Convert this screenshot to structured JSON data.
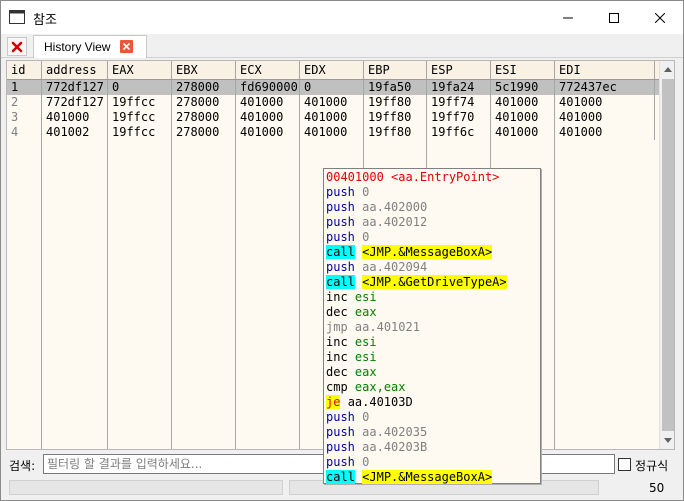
{
  "window": {
    "title": "참조"
  },
  "tabs": {
    "history_label": "History View"
  },
  "table": {
    "columns": [
      "id",
      "address",
      "EAX",
      "EBX",
      "ECX",
      "EDX",
      "EBP",
      "ESP",
      "ESI",
      "EDI"
    ],
    "rows": [
      [
        "1",
        "772df127",
        "0",
        "278000",
        "fd690000",
        "0",
        "19fa50",
        "19fa24",
        "5c1990",
        "772437ec"
      ],
      [
        "2",
        "772df127",
        "19ffcc",
        "278000",
        "401000",
        "401000",
        "19ff80",
        "19ff74",
        "401000",
        "401000"
      ],
      [
        "3",
        "401000",
        "19ffcc",
        "278000",
        "401000",
        "401000",
        "19ff80",
        "19ff70",
        "401000",
        "401000"
      ],
      [
        "4",
        "401002",
        "19ffcc",
        "278000",
        "401000",
        "401000",
        "19ff80",
        "19ff6c",
        "401000",
        "401000"
      ]
    ],
    "selected_row": "1"
  },
  "disassembly": {
    "header": "00401000 <aa.EntryPoint>",
    "lines": [
      {
        "mn": "push",
        "op": "0",
        "style": "push",
        "opstyle": "num"
      },
      {
        "mn": "push",
        "op": "aa.402000",
        "style": "push",
        "opstyle": "addr"
      },
      {
        "mn": "push",
        "op": "aa.402012",
        "style": "push",
        "opstyle": "addr"
      },
      {
        "mn": "push",
        "op": "0",
        "style": "push",
        "opstyle": "num"
      },
      {
        "mn": "call",
        "op": "<JMP.&MessageBoxA>",
        "style": "call",
        "opstyle": "label"
      },
      {
        "mn": "push",
        "op": "aa.402094",
        "style": "push",
        "opstyle": "addr"
      },
      {
        "mn": "call",
        "op": "<JMP.&GetDriveTypeA>",
        "style": "call",
        "opstyle": "label"
      },
      {
        "mn": "inc",
        "op": "esi",
        "style": "plain",
        "opstyle": "reg"
      },
      {
        "mn": "dec",
        "op": "eax",
        "style": "plain",
        "opstyle": "reg"
      },
      {
        "mn": "jmp",
        "op": "aa.401021",
        "style": "jmp",
        "opstyle": "addr"
      },
      {
        "mn": "inc",
        "op": "esi",
        "style": "plain",
        "opstyle": "reg"
      },
      {
        "mn": "inc",
        "op": "esi",
        "style": "plain",
        "opstyle": "reg"
      },
      {
        "mn": "dec",
        "op": "eax",
        "style": "plain",
        "opstyle": "reg"
      },
      {
        "mn": "cmp",
        "op": "eax,eax",
        "style": "plain",
        "opstyle": "reg"
      },
      {
        "mn": "je",
        "op": "aa.40103D",
        "style": "je",
        "opstyle": "plainlabel"
      },
      {
        "mn": "push",
        "op": "0",
        "style": "push",
        "opstyle": "num"
      },
      {
        "mn": "push",
        "op": "aa.402035",
        "style": "push",
        "opstyle": "addr"
      },
      {
        "mn": "push",
        "op": "aa.40203B",
        "style": "push",
        "opstyle": "addr"
      },
      {
        "mn": "push",
        "op": "0",
        "style": "push",
        "opstyle": "num"
      },
      {
        "mn": "call",
        "op": "<JMP.&MessageBoxA>",
        "style": "call",
        "opstyle": "label"
      }
    ]
  },
  "search": {
    "label": "검색:",
    "placeholder": "필터링 할 결과를 입력하세요...",
    "value": "",
    "regex_label": "정규식",
    "regex_checked": false
  },
  "footer": {
    "count": "50"
  },
  "icons": {
    "close_all": "red-x-icon",
    "tab_close": "close-icon",
    "app": "window-icon"
  },
  "colors": {
    "selected_row": "#c0c0c0",
    "table_bg": "#fffaf1",
    "call_highlight": "#00ffff",
    "label_highlight": "#ffff00",
    "header_address": "#e00000"
  }
}
